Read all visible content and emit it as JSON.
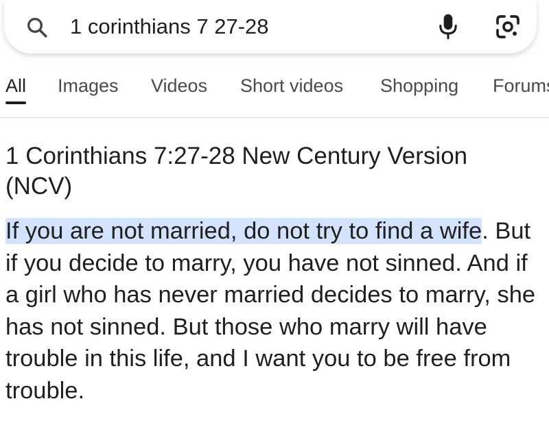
{
  "search": {
    "query": "1 corinthians 7 27-28",
    "icons": {
      "left": "search-icon",
      "voice": "microphone-icon",
      "lens": "google-lens-icon"
    }
  },
  "tabs": [
    {
      "label": "All",
      "active": true
    },
    {
      "label": "Images",
      "active": false
    },
    {
      "label": "Videos",
      "active": false
    },
    {
      "label": "Short videos",
      "active": false
    },
    {
      "label": "Shopping",
      "active": false
    },
    {
      "label": "Forums",
      "active": false
    }
  ],
  "result": {
    "title": "1 Corinthians 7:27-28 New Century Version (NCV)",
    "highlighted_text": "If you are not married, do not try to find a wife",
    "remaining_text": ". But if you decide to marry, you have not sinned. And if a girl who has never married decides to marry, she has not sinned. But those who marry will have trouble in this life, and I want you to be free from trouble."
  },
  "colors": {
    "highlight": "#d3e3fd",
    "text": "#1f1f1f",
    "tab_inactive": "#4a4a4a"
  }
}
